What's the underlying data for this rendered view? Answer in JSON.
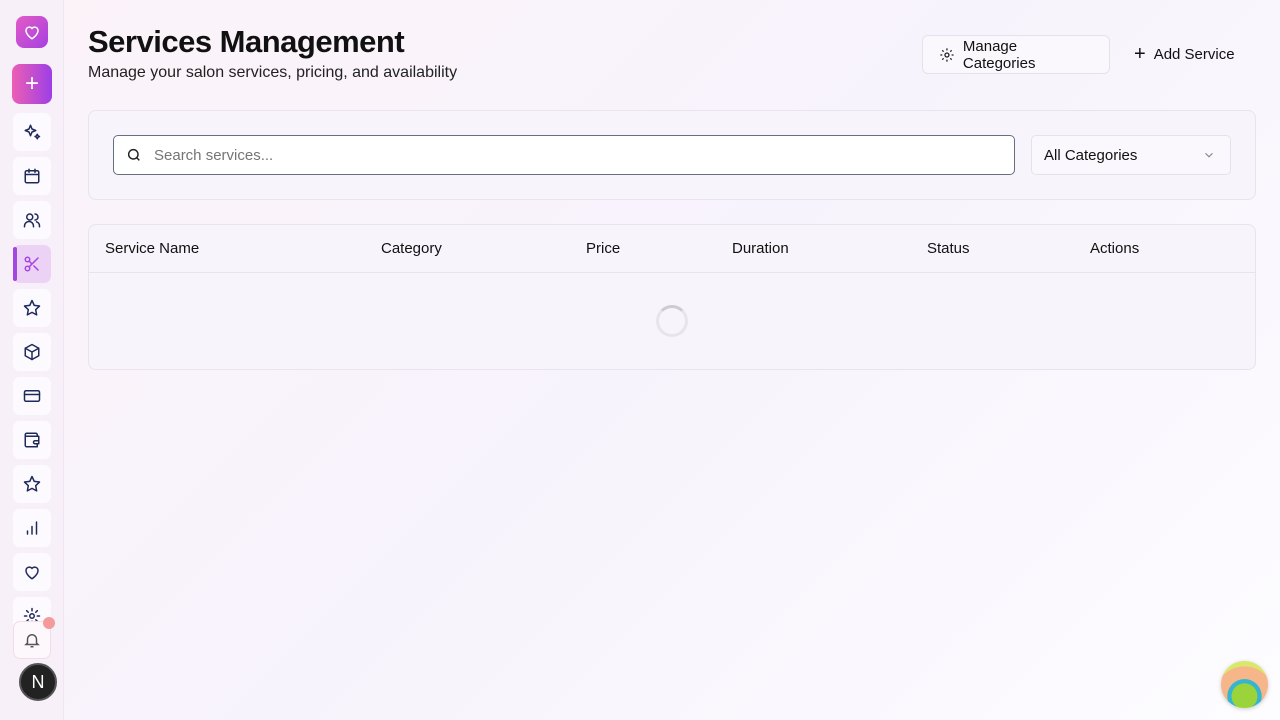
{
  "sidebar": {
    "items": [
      {
        "name": "sparkles"
      },
      {
        "name": "calendar"
      },
      {
        "name": "users"
      },
      {
        "name": "scissors",
        "active": true
      },
      {
        "name": "star"
      },
      {
        "name": "package"
      },
      {
        "name": "credit-card"
      },
      {
        "name": "wallet"
      },
      {
        "name": "star"
      },
      {
        "name": "bar-chart"
      },
      {
        "name": "heart"
      },
      {
        "name": "settings"
      }
    ],
    "avatar_initial": "N"
  },
  "header": {
    "title": "Services Management",
    "subtitle": "Manage your salon services, pricing, and availability"
  },
  "actions": {
    "manage_categories": "Manage Categories",
    "add_service": "Add Service"
  },
  "filters": {
    "search_placeholder": "Search services...",
    "search_value": "",
    "category_selected": "All Categories"
  },
  "table": {
    "columns": [
      "Service Name",
      "Category",
      "Price",
      "Duration",
      "Status",
      "Actions"
    ],
    "rows": [],
    "loading": true
  },
  "colors": {
    "accent": "#a347e0",
    "active_bg": "#ecd3f6"
  }
}
